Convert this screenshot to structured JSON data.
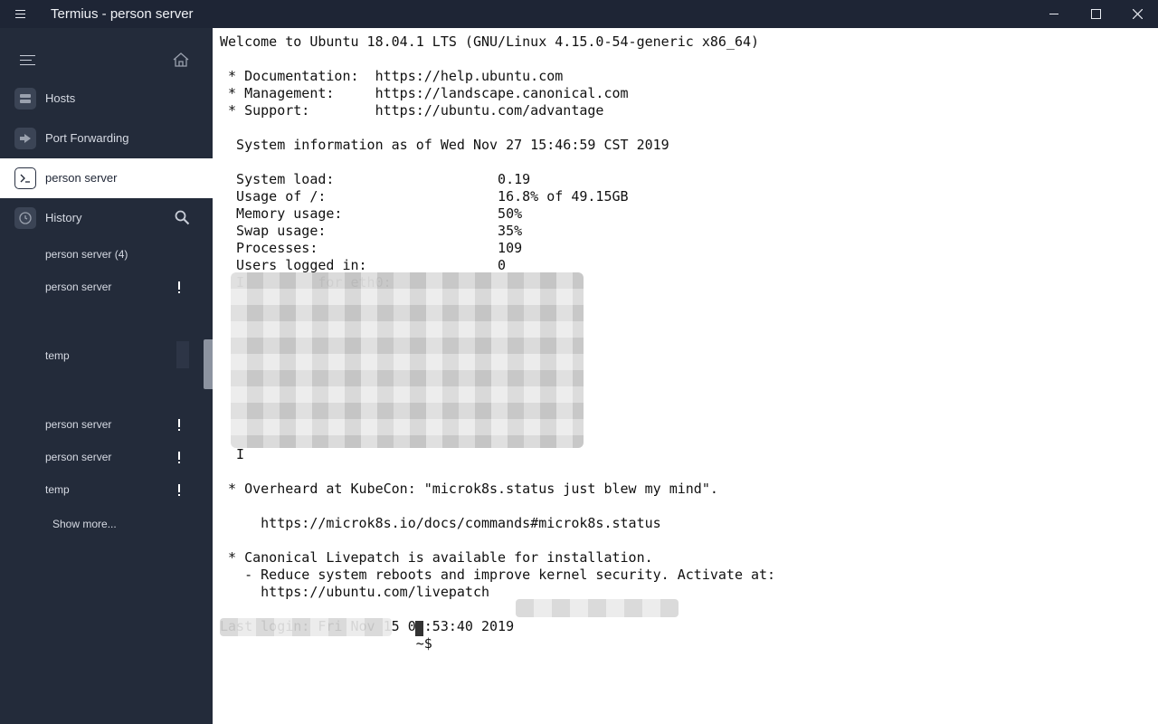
{
  "window": {
    "title": "Termius - person server"
  },
  "sidebar": {
    "nav": [
      {
        "label": "Hosts",
        "icon": "hosts-icon"
      },
      {
        "label": "Port Forwarding",
        "icon": "port-forwarding-icon"
      },
      {
        "label": "person server",
        "icon": "terminal-icon",
        "active": true
      }
    ],
    "history": {
      "label": "History",
      "items": [
        {
          "label": "person server (4)",
          "warning": false
        },
        {
          "label": "person server",
          "warning": true
        },
        {
          "label": "temp",
          "warning": false
        },
        {
          "label": "person server",
          "warning": true
        },
        {
          "label": "person server",
          "warning": true
        },
        {
          "label": "temp",
          "warning": true
        }
      ],
      "show_more": "Show more..."
    }
  },
  "terminal": {
    "lines": [
      "Welcome to Ubuntu 18.04.1 LTS (GNU/Linux 4.15.0-54-generic x86_64)",
      "",
      " * Documentation:  https://help.ubuntu.com",
      " * Management:     https://landscape.canonical.com",
      " * Support:        https://ubuntu.com/advantage",
      "",
      "  System information as of Wed Nov 27 15:46:59 CST 2019",
      "",
      "  System load:                    0.19",
      "  Usage of /:                     16.8% of 49.15GB",
      "  Memory usage:                   50%",
      "  Swap usage:                     35%",
      "  Processes:                      109",
      "  Users logged in:                0",
      "  I         for eth0:",
      "",
      "",
      "",
      "",
      "",
      "",
      "",
      "",
      "",
      "  I",
      "",
      " * Overheard at KubeCon: \"microk8s.status just blew my mind\".",
      "",
      "     https://microk8s.io/docs/commands#microk8s.status",
      "",
      " * Canonical Livepatch is available for installation.",
      "   - Reduce system reboots and improve kernel security. Activate at:",
      "     https://ubuntu.com/livepatch",
      "",
      "Last login: Fri Nov 15 09:53:40 2019",
      "                        ~$ "
    ]
  }
}
